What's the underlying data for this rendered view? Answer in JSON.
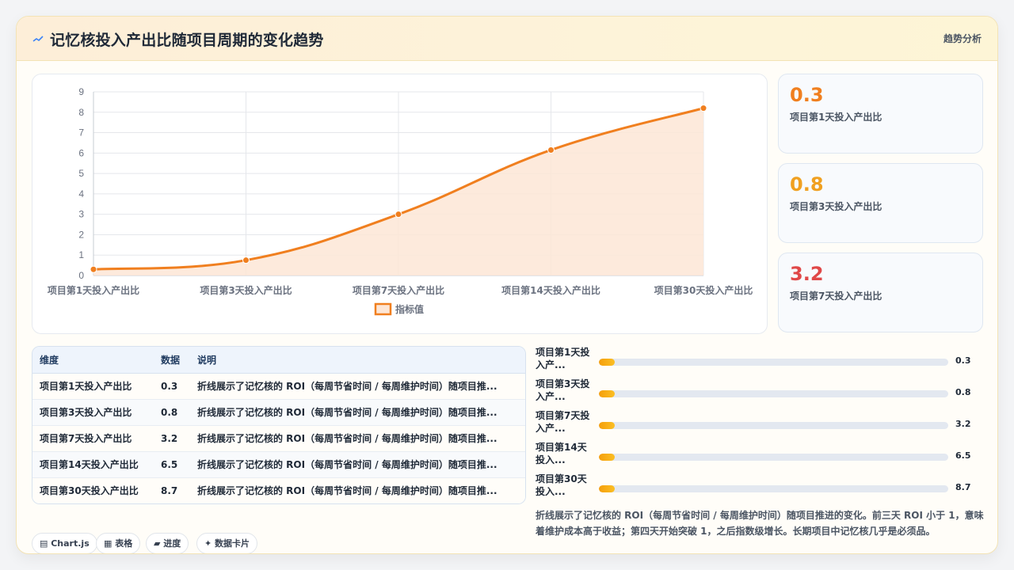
{
  "header": {
    "title": "记忆核投入产出比随项目周期的变化趋势",
    "tag": "趋势分析",
    "icon": "trend-line-icon"
  },
  "chart_data": {
    "type": "line",
    "categories": [
      "项目第1天投入产出比",
      "项目第3天投入产出比",
      "项目第7天投入产出比",
      "项目第14天投入产出比",
      "项目第30天投入产出比"
    ],
    "series": [
      {
        "name": "指标值",
        "values": [
          0.3,
          0.75,
          3.0,
          6.15,
          8.2
        ]
      }
    ],
    "ylim": [
      0,
      9
    ],
    "yticks": [
      "0",
      "1",
      "2",
      "3",
      "4",
      "5",
      "6",
      "7",
      "8",
      "9"
    ],
    "grid": true,
    "legend": "bottom",
    "colors": {
      "line": "#f07f1f",
      "area": "#fde6d6"
    }
  },
  "stats": [
    {
      "value": "0.3",
      "label": "项目第1天投入产出比",
      "color": "#f07f1f"
    },
    {
      "value": "0.8",
      "label": "项目第3天投入产出比",
      "color": "#f0a020"
    },
    {
      "value": "3.2",
      "label": "项目第7天投入产出比",
      "color": "#e04848"
    }
  ],
  "table": {
    "headers": [
      "维度",
      "数据",
      "说明"
    ],
    "rows": [
      [
        "项目第1天投入产出比",
        "0.3",
        "折线展示了记忆核的 ROI（每周节省时间 / 每周维护时间）随项目推..."
      ],
      [
        "项目第3天投入产出比",
        "0.8",
        "折线展示了记忆核的 ROI（每周节省时间 / 每周维护时间）随项目推..."
      ],
      [
        "项目第7天投入产出比",
        "3.2",
        "折线展示了记忆核的 ROI（每周节省时间 / 每周维护时间）随项目推..."
      ],
      [
        "项目第14天投入产出比",
        "6.5",
        "折线展示了记忆核的 ROI（每周节省时间 / 每周维护时间）随项目推..."
      ],
      [
        "项目第30天投入产出比",
        "8.7",
        "折线展示了记忆核的 ROI（每周节省时间 / 每周维护时间）随项目推..."
      ]
    ]
  },
  "progress": [
    {
      "label": "项目第1天投入产...",
      "value": "0.3",
      "fraction": 0.03
    },
    {
      "label": "项目第3天投入产...",
      "value": "0.8",
      "fraction": 0.03
    },
    {
      "label": "项目第7天投入产...",
      "value": "3.2",
      "fraction": 0.03
    },
    {
      "label": "项目第14天投入...",
      "value": "6.5",
      "fraction": 0.03
    },
    {
      "label": "项目第30天投入...",
      "value": "8.7",
      "fraction": 0.03
    }
  ],
  "description": "折线展示了记忆核的 ROI（每周节省时间 / 每周维护时间）随项目推进的变化。前三天 ROI 小于 1，意味着维护成本高于收益；第四天开始突破 1，之后指数级增长。长期项目中记忆核几乎是必须品。",
  "chips": [
    {
      "icon": "chart-icon",
      "label": "Chart.js"
    },
    {
      "icon": "table-icon",
      "label": "表格"
    },
    {
      "icon": "progress-icon",
      "label": "进度"
    },
    {
      "icon": "sparkle-icon",
      "label": "数据卡片"
    }
  ]
}
